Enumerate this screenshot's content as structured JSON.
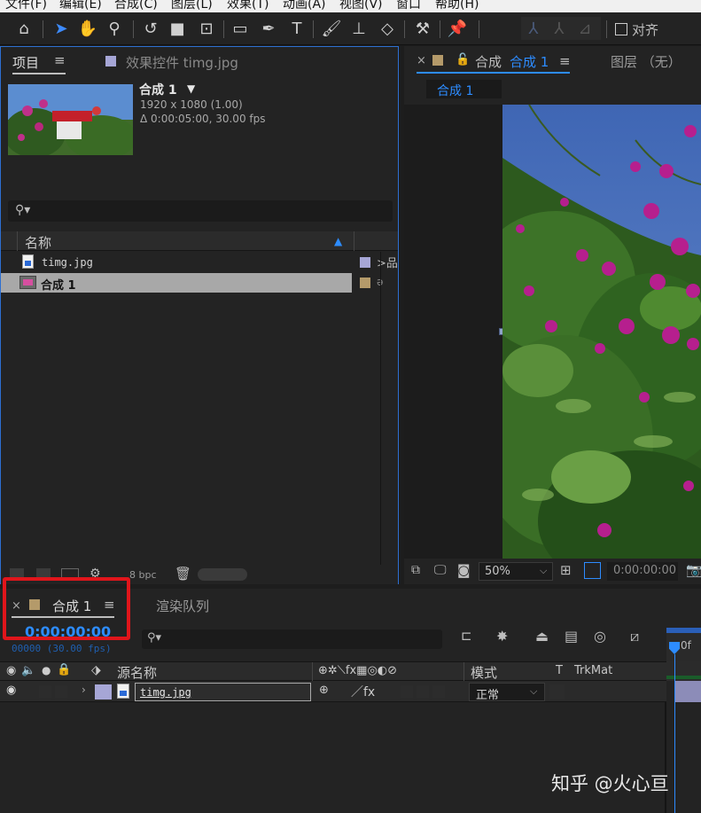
{
  "menu": [
    "文件(F)",
    "编辑(E)",
    "合成(C)",
    "图层(L)",
    "效果(T)",
    "动画(A)",
    "视图(V)",
    "窗口",
    "帮助(H)"
  ],
  "toolbar": {
    "align_label": "对齐"
  },
  "project": {
    "tab_label": "项目",
    "effects_tab": "效果控件 timg.jpg",
    "selected_name": "合成 1",
    "resolution": "1920 x 1080 (1.00)",
    "duration": "Δ 0:00:05:00, 30.00 fps",
    "name_col": "名称",
    "items": [
      {
        "name": "timg.jpg"
      },
      {
        "name": "合成 1"
      }
    ],
    "bpc": "8 bpc"
  },
  "comp_viewer": {
    "tab_label": "合成",
    "tab_name": "合成 1",
    "layer_tab": "图层 （无）",
    "breadcrumb": "合成 1",
    "zoom": "50%",
    "timecode": "0:00:00:00"
  },
  "timeline": {
    "tab_label": "合成 1",
    "render_tab": "渲染队列",
    "timecode": "0:00:00:00",
    "frames": "00000 (30.00 fps)",
    "columns": {
      "source_name": "源名称",
      "mode": "模式",
      "t": "T",
      "trkmat": "TrkMat"
    },
    "layer": {
      "name": "timg.jpg",
      "mode": "正常"
    },
    "ruler_label": "0f"
  },
  "watermark": "知乎 @火心亘",
  "colors": {
    "accent": "#2d8cff",
    "highlight_box": "#e0151b",
    "comp_swatch": "#b49a6a",
    "footage_swatch": "#a6a6d6"
  }
}
